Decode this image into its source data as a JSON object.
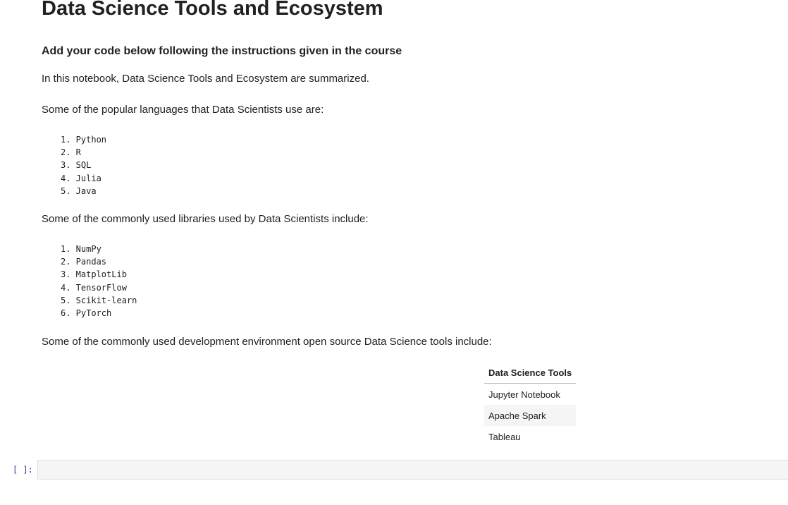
{
  "notebook": {
    "title": "Data Science Tools and Ecosystem",
    "subheading": "Add your code below following the instructions given in the course",
    "intro": "In this notebook, Data Science Tools and Ecosystem are summarized.",
    "languages_intro": "Some of the popular languages that Data Scientists use are:",
    "languages": [
      "1. Python",
      "2. R",
      "3. SQL",
      "4. Julia",
      "5. Java"
    ],
    "libraries_intro": "Some of the commonly used libraries used by Data Scientists include:",
    "libraries": [
      "1. NumPy",
      "2. Pandas",
      "3. MatplotLib",
      "4. TensorFlow",
      "5. Scikit-learn",
      "6. PyTorch"
    ],
    "tools_intro": "Some of the commonly used development environment open source Data Science tools include:",
    "tools_table": {
      "header": "Data Science Tools",
      "rows": [
        "Jupyter Notebook",
        "Apache Spark",
        "Tableau"
      ]
    },
    "code_cell": {
      "prompt": "[ ]:",
      "value": ""
    }
  }
}
